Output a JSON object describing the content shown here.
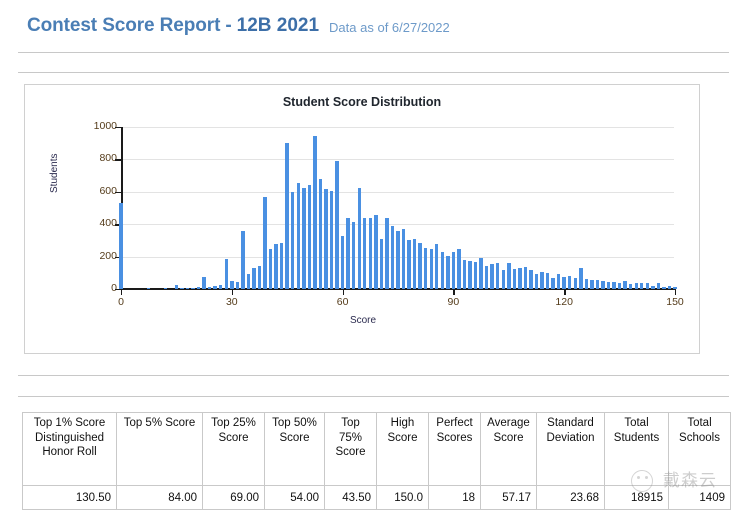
{
  "header": {
    "title": "Contest Score Report",
    "separator": "-",
    "contest": "12B 2021",
    "data_as_of": "Data as of 6/27/2022",
    "accent_color": "#4a7eb5"
  },
  "chart_panel": {
    "title": "Student Score Distribution"
  },
  "chart_data": {
    "type": "bar",
    "title": "Student Score Distribution",
    "xlabel": "Score",
    "ylabel": "Students",
    "xlim": [
      0,
      150
    ],
    "ylim": [
      0,
      1000
    ],
    "xticks": [
      0,
      30,
      60,
      90,
      120,
      150
    ],
    "yticks": [
      0,
      200,
      400,
      600,
      800,
      1000
    ],
    "grid": true,
    "legend": "none",
    "bin_width": 1.5,
    "bar_color": "#4a90e2",
    "x": [
      0,
      1.5,
      3,
      4.5,
      6,
      7.5,
      9,
      10.5,
      12,
      13.5,
      15,
      16.5,
      18,
      19.5,
      21,
      22.5,
      24,
      25.5,
      27,
      28.5,
      30,
      31.5,
      33,
      34.5,
      36,
      37.5,
      39,
      40.5,
      42,
      43.5,
      45,
      46.5,
      48,
      49.5,
      51,
      52.5,
      54,
      55.5,
      57,
      58.5,
      60,
      61.5,
      63,
      64.5,
      66,
      67.5,
      69,
      70.5,
      72,
      73.5,
      75,
      76.5,
      78,
      79.5,
      81,
      82.5,
      84,
      85.5,
      87,
      88.5,
      90,
      91.5,
      93,
      94.5,
      96,
      97.5,
      99,
      100.5,
      102,
      103.5,
      105,
      106.5,
      108,
      109.5,
      111,
      112.5,
      114,
      115.5,
      117,
      118.5,
      120,
      121.5,
      123,
      124.5,
      126,
      127.5,
      129,
      130.5,
      132,
      133.5,
      135,
      136.5,
      138,
      139.5,
      141,
      142.5,
      144,
      145.5,
      147,
      148.5,
      150
    ],
    "values": [
      530,
      0,
      0,
      0,
      0,
      8,
      0,
      0,
      6,
      0,
      22,
      8,
      8,
      7,
      12,
      75,
      14,
      20,
      25,
      183,
      50,
      45,
      358,
      95,
      130,
      145,
      570,
      245,
      280,
      285,
      900,
      600,
      655,
      625,
      640,
      945,
      680,
      615,
      605,
      790,
      330,
      440,
      415,
      625,
      440,
      440,
      455,
      310,
      440,
      390,
      360,
      370,
      305,
      310,
      285,
      255,
      250,
      275,
      230,
      205,
      230,
      250,
      180,
      175,
      165,
      190,
      145,
      155,
      160,
      120,
      160,
      125,
      130,
      135,
      115,
      90,
      105,
      100,
      70,
      95,
      75,
      80,
      65,
      130,
      60,
      55,
      55,
      50,
      45,
      45,
      35,
      50,
      30,
      35,
      35,
      35,
      20,
      35,
      15,
      18,
      10
    ]
  },
  "stats_table": {
    "columns": [
      "Top 1% Score Distinguished Honor Roll",
      "Top 5% Score",
      "Top 25% Score",
      "Top 50% Score",
      "Top 75% Score",
      "High Score",
      "Perfect Scores",
      "Average Score",
      "Standard Deviation",
      "Total Students",
      "Total Schools"
    ],
    "rows": [
      [
        "130.50",
        "84.00",
        "69.00",
        "54.00",
        "43.50",
        "150.0",
        "18",
        "57.17",
        "23.68",
        "18915",
        "1409"
      ]
    ]
  },
  "watermark": {
    "text": "戴森云"
  }
}
